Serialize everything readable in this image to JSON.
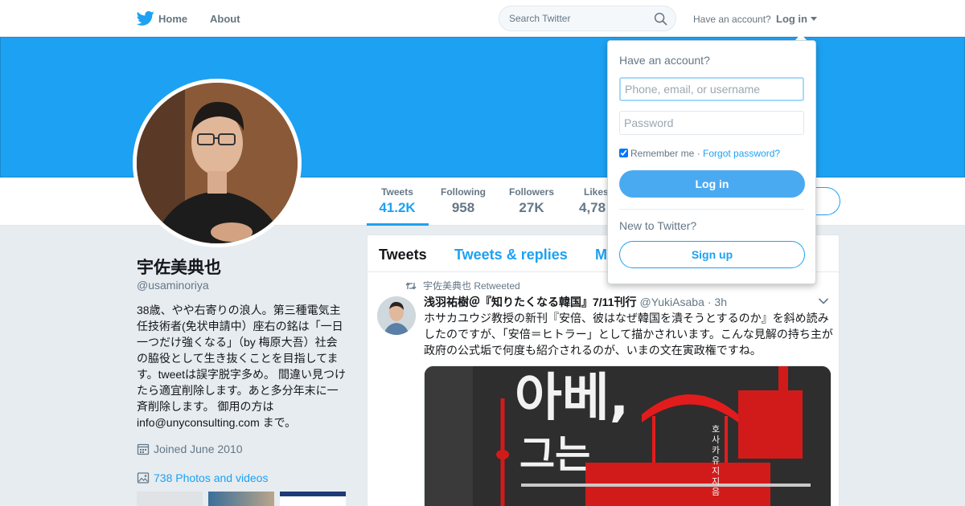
{
  "nav": {
    "home_label": "Home",
    "about_label": "About",
    "search_placeholder": "Search Twitter",
    "have_account": "Have an account?",
    "login_label": "Log in"
  },
  "profile_nav": {
    "stats": [
      {
        "label": "Tweets",
        "value": "41.2K",
        "active": true
      },
      {
        "label": "Following",
        "value": "958"
      },
      {
        "label": "Followers",
        "value": "27K"
      },
      {
        "label": "Likes",
        "value": "4,78"
      }
    ]
  },
  "profile": {
    "name": "宇佐美典也",
    "handle": "@usaminoriya",
    "bio": "38歳、やや右寄りの浪人。第三種電気主任技術者(免状申請中）座右の銘は「一日一つだけ強くなる」（by 梅原大吾）社会の脇役として生き抜くことを目指してます。tweetは誤字脱字多め。 間違い見つけたら適宜削除します。あと多分年末に一斉削除します。 御用の方は info@unyconsulting.com まで。",
    "joined": "Joined June 2010",
    "photos": "738 Photos and videos"
  },
  "timeline": {
    "tabs": [
      "Tweets",
      "Tweets & replies",
      "M"
    ],
    "tweet": {
      "retweeted_by": "宇佐美典也 Retweeted",
      "author_name": "浅羽祐樹＠『知りたくなる韓国』7/11刊行",
      "author_handle": "@YukiAsaba",
      "time": "· 3h",
      "text": "ホサカユウジ教授の新刊『安倍、彼はなぜ韓国を潰そうとするのか』を斜め読みしたのですが、「安倍＝ヒトラー」として描かされいます。こんな見解の持ち主が政府の公式垢で何度も紹介されるのが、いまの文在寅政権ですね。",
      "media_text_1": "아베,",
      "media_text_2": "그는",
      "media_author": "호사카 유지 지음"
    }
  },
  "login_dropdown": {
    "title": "Have an account?",
    "username_placeholder": "Phone, email, or username",
    "password_placeholder": "Password",
    "remember_me": "Remember me",
    "separator": " · ",
    "forgot_password": "Forgot password?",
    "login_button": "Log in",
    "new_to_twitter": "New to Twitter?",
    "signup_button": "Sign up"
  },
  "colors": {
    "brand_blue": "#1da1f2",
    "banner": "#1da1f2",
    "page_bg": "#e6ecf0"
  }
}
